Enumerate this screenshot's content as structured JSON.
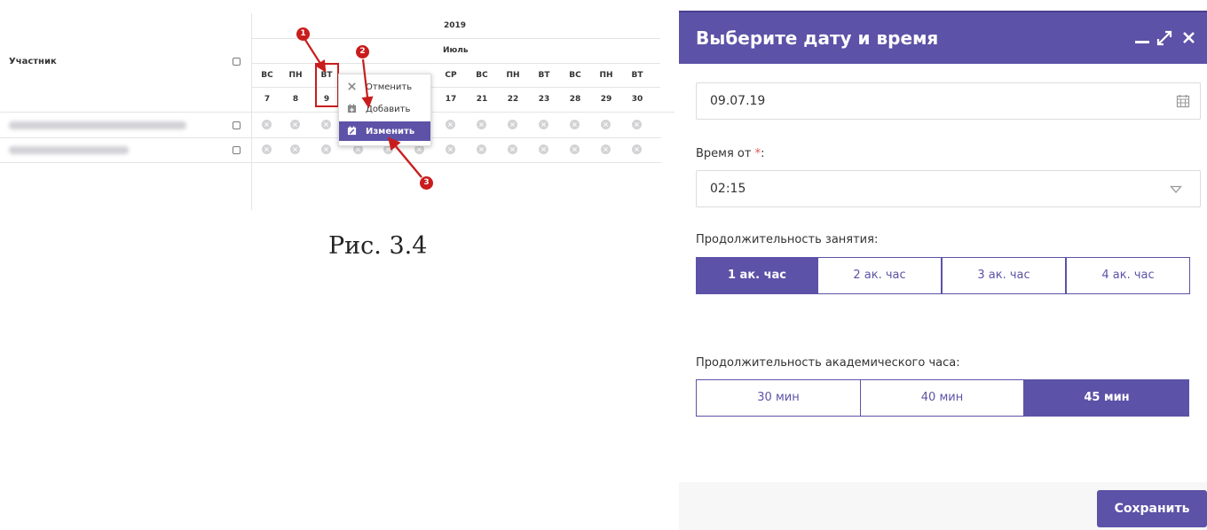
{
  "table": {
    "participant_header": "Участник",
    "year": "2019",
    "month": "Июль",
    "columns": [
      {
        "weekday": "ВС",
        "day": "7"
      },
      {
        "weekday": "ПН",
        "day": "8"
      },
      {
        "weekday": "ВТ",
        "day": "9"
      },
      {
        "weekday": "",
        "day": ""
      },
      {
        "weekday": "",
        "day": ""
      },
      {
        "weekday": "",
        "day": ""
      },
      {
        "weekday": "СР",
        "day": "17"
      },
      {
        "weekday": "ВС",
        "day": "21"
      },
      {
        "weekday": "ПН",
        "day": "22"
      },
      {
        "weekday": "ВТ",
        "day": "23"
      },
      {
        "weekday": "ВС",
        "day": "28"
      },
      {
        "weekday": "ПН",
        "day": "29"
      },
      {
        "weekday": "ВТ",
        "day": "30"
      }
    ],
    "context_menu": [
      {
        "label": "Отменить",
        "icon": "close-icon"
      },
      {
        "label": "Добавить",
        "icon": "calendar-add-icon"
      },
      {
        "label": "Изменить",
        "icon": "calendar-edit-icon"
      }
    ],
    "badges": [
      "1",
      "2",
      "3"
    ],
    "annotation_color": "#c91d1d"
  },
  "caption": "Рис. 3.4",
  "dialog": {
    "title": "Выберите дату и время",
    "date_value": "09.07.19",
    "time_label": "Время от",
    "time_required_mark": "*",
    "time_suffix": ":",
    "time_value": "02:15",
    "duration_label": "Продолжительность занятия:",
    "duration_options": [
      "1 ак. час",
      "2 ак. час",
      "3 ак. час",
      "4 ак. час"
    ],
    "duration_selected": "1 ак. час",
    "acad_hour_label": "Продолжительность академического часа:",
    "acad_hour_options": [
      "30 мин",
      "40 мин",
      "45 мин"
    ],
    "acad_hour_selected": "45 мин",
    "save_label": "Сохранить",
    "accent_color": "#5c52a7"
  }
}
